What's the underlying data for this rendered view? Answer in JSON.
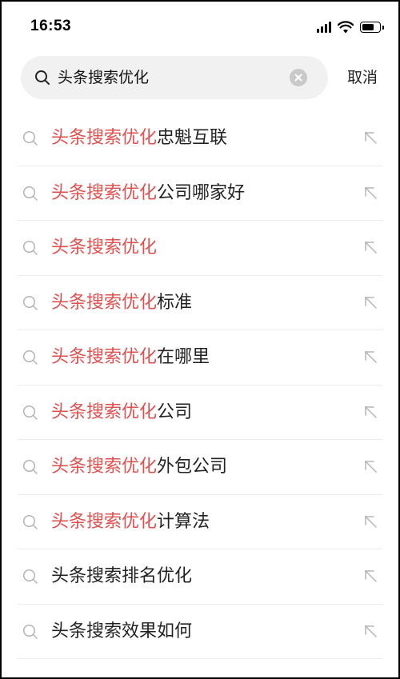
{
  "status_bar": {
    "time": "16:53"
  },
  "search": {
    "query": "头条搜索优化",
    "cancel_label": "取消"
  },
  "suggestions": [
    {
      "highlight": "头条搜索优化",
      "rest": "忠魁互联"
    },
    {
      "highlight": "头条搜索优化",
      "rest": "公司哪家好"
    },
    {
      "highlight": "头条搜索优化",
      "rest": ""
    },
    {
      "highlight": "头条搜索优化",
      "rest": "标准"
    },
    {
      "highlight": "头条搜索优化",
      "rest": "在哪里"
    },
    {
      "highlight": "头条搜索优化",
      "rest": "公司"
    },
    {
      "highlight": "头条搜索优化",
      "rest": "外包公司"
    },
    {
      "highlight": "头条搜索优化",
      "rest": "计算法"
    },
    {
      "highlight": "",
      "rest": "头条搜索排名优化"
    },
    {
      "highlight": "",
      "rest": "头条搜索效果如何"
    }
  ],
  "colors": {
    "highlight": "#e0504e",
    "text": "#222222",
    "search_bg": "#f1f1f1",
    "icon_gray": "#b5b5b5"
  },
  "icons": {
    "search": "search-icon",
    "clear": "clear-icon",
    "fill_query": "arrow-up-left-icon"
  }
}
